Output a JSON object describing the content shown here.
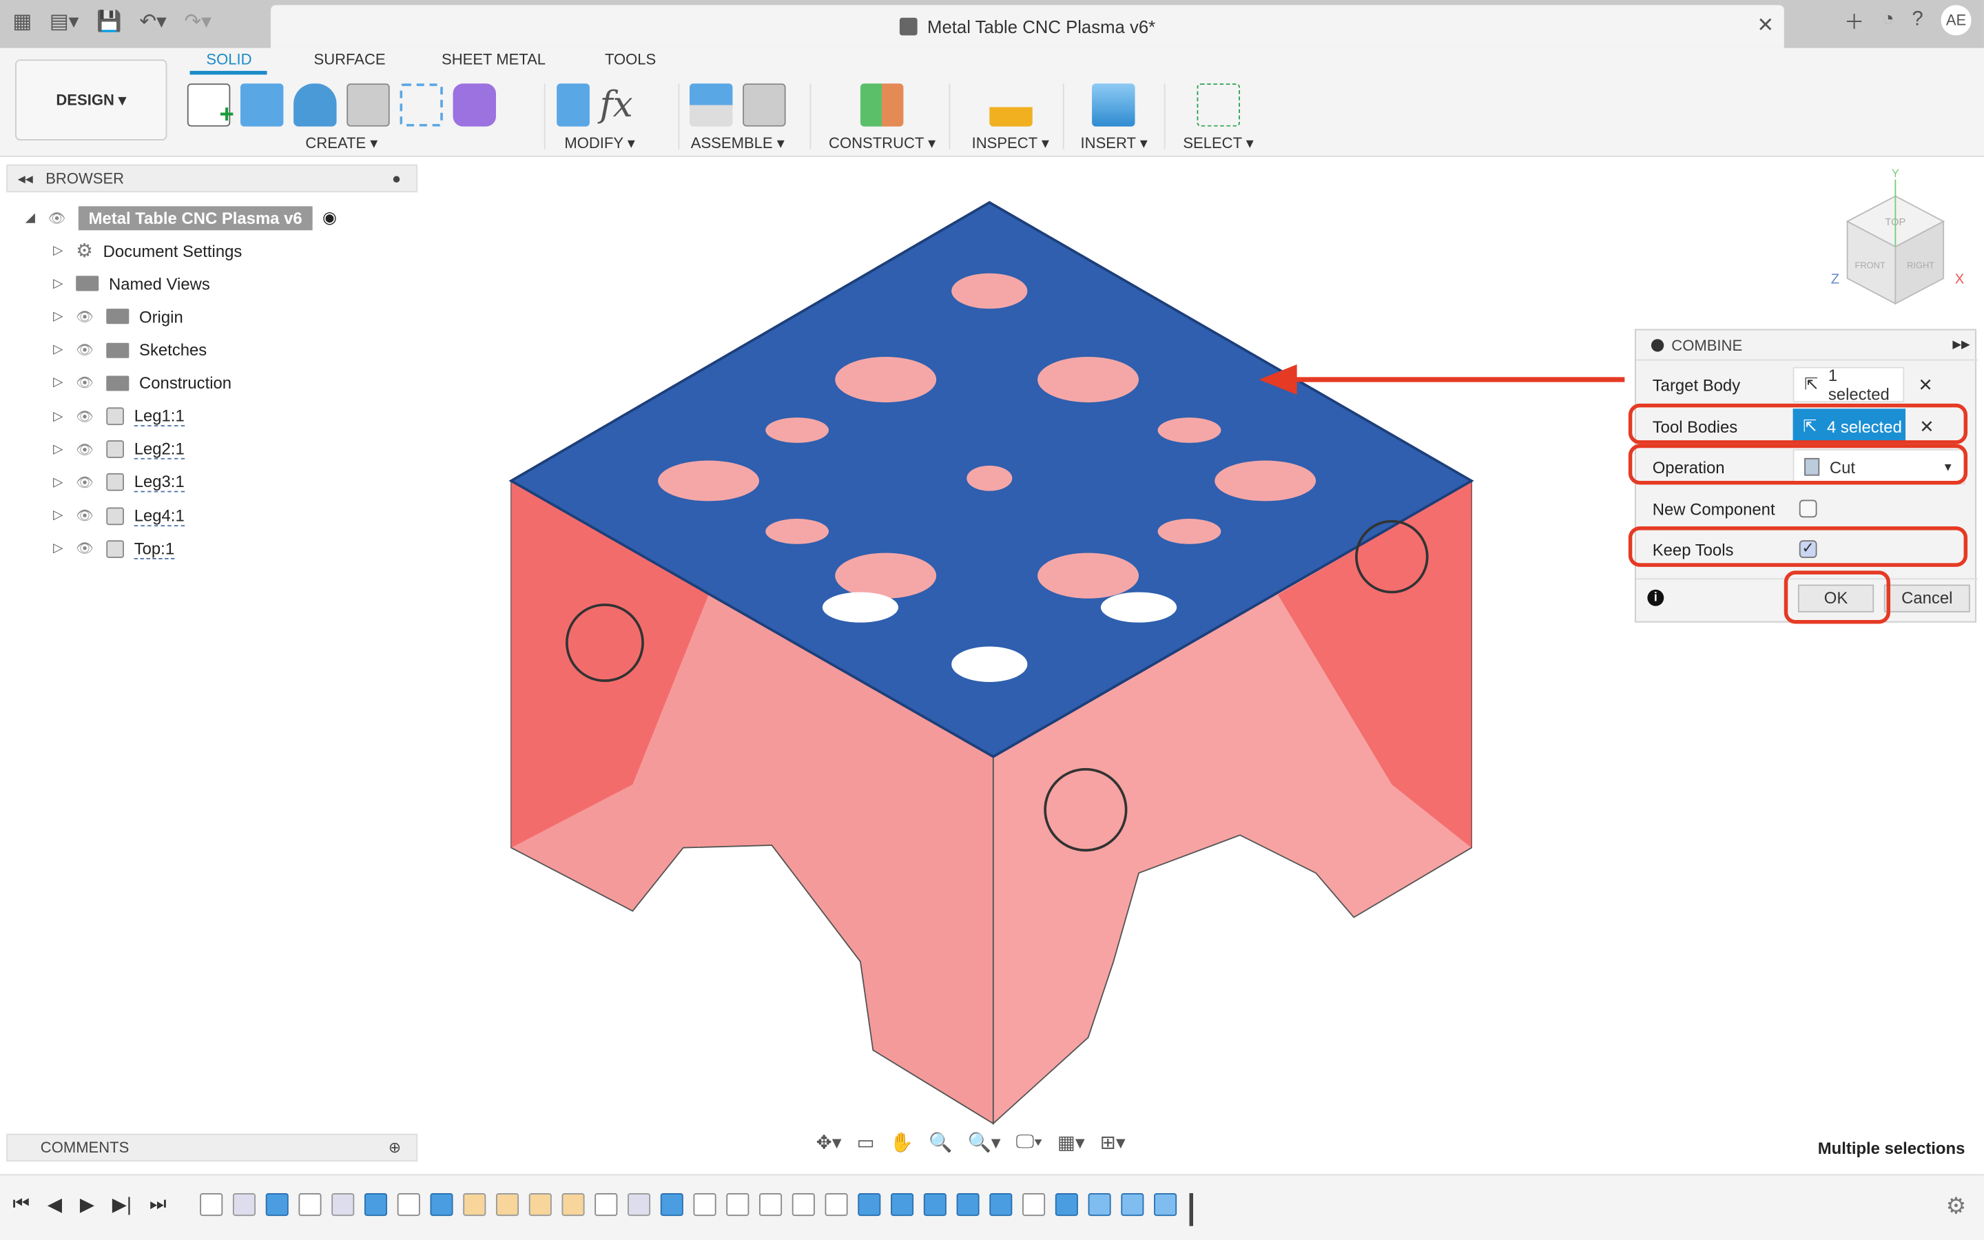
{
  "title": "Metal Table CNC Plasma v6*",
  "user_initials": "AE",
  "workspace": "DESIGN ▾",
  "tabs": [
    "SOLID",
    "SURFACE",
    "SHEET METAL",
    "TOOLS"
  ],
  "groups": {
    "create": "CREATE ▾",
    "modify": "MODIFY ▾",
    "assemble": "ASSEMBLE ▾",
    "construct": "CONSTRUCT ▾",
    "inspect": "INSPECT ▾",
    "insert": "INSERT ▾",
    "select": "SELECT ▾"
  },
  "browser": {
    "title": "BROWSER",
    "root": "Metal Table CNC Plasma v6",
    "items": [
      {
        "label": "Document Settings",
        "icon": "gear-icon"
      },
      {
        "label": "Named Views",
        "icon": "folder-icon"
      },
      {
        "label": "Origin",
        "icon": "folder-icon"
      },
      {
        "label": "Sketches",
        "icon": "folder-icon"
      },
      {
        "label": "Construction",
        "icon": "folder-icon"
      },
      {
        "label": "Leg1:1",
        "icon": "component-icon"
      },
      {
        "label": "Leg2:1",
        "icon": "component-icon"
      },
      {
        "label": "Leg3:1",
        "icon": "component-icon"
      },
      {
        "label": "Leg4:1",
        "icon": "component-icon"
      },
      {
        "label": "Top:1",
        "icon": "component-icon"
      }
    ]
  },
  "comments": "COMMENTS",
  "combine": {
    "title": "COMBINE",
    "target_body_label": "Target Body",
    "target_body_value": "1 selected",
    "tool_bodies_label": "Tool Bodies",
    "tool_bodies_value": "4 selected",
    "operation_label": "Operation",
    "operation_value": "Cut",
    "new_component_label": "New Component",
    "new_component_checked": false,
    "keep_tools_label": "Keep Tools",
    "keep_tools_checked": true,
    "ok": "OK",
    "cancel": "Cancel",
    "highlight_color": "#e53a24",
    "selection_color": "#1b8fd4"
  },
  "status": "Multiple selections",
  "viewcube": {
    "top": "TOP",
    "front": "FRONT",
    "right": "RIGHT",
    "x": "X",
    "y": "Y",
    "z": "Z"
  },
  "timeline": [
    "sk",
    "bd",
    "ex",
    "sk",
    "bd",
    "ex",
    "sk",
    "ex",
    "pl",
    "pl",
    "pl",
    "pl",
    "sk",
    "bd",
    "ex",
    "sk",
    "sk",
    "sk",
    "sk",
    "sk",
    "ex",
    "ex",
    "ex",
    "ex",
    "ex",
    "sk",
    "ex",
    "cb",
    "cb",
    "cb"
  ]
}
